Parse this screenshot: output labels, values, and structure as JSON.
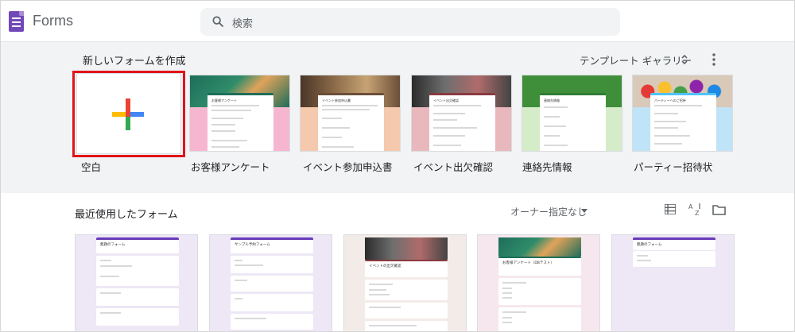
{
  "header": {
    "app_title": "Forms",
    "search_placeholder": "検索"
  },
  "templates": {
    "section_title": "新しいフォームを作成",
    "gallery_label": "テンプレート ギャラリー",
    "items": [
      {
        "label": "空白"
      },
      {
        "label": "お客様アンケート",
        "form_title": "お客様アンケート",
        "banner_color": "#1e6d5a",
        "bg_color": "#f6b6cf"
      },
      {
        "label": "イベント参加申込書",
        "form_title": "イベント参加申込書",
        "banner_color": "#5a4330",
        "bg_color": "#f5c9ad"
      },
      {
        "label": "イベント出欠確認",
        "form_title": "イベント出欠確認",
        "banner_color": "#3a3a3a",
        "bg_color": "#e9b8bd"
      },
      {
        "label": "連絡先情報",
        "form_title": "連絡先情報",
        "banner_color": "#3f8f3a",
        "bg_color": "#d4ecc8"
      },
      {
        "label": "パーティー招待状",
        "form_title": "パーティーへのご招待",
        "banner_color": "#c9d7e6",
        "bg_color": "#bfe3f7"
      }
    ]
  },
  "recent": {
    "section_title": "最近使用したフォーム",
    "owner_filter": "オーナー指定なし",
    "forms": [
      {
        "title": "無題のフォーム"
      },
      {
        "title": "サンプル予約フォーム"
      },
      {
        "title": "イベントの出欠確認"
      },
      {
        "title": "お客様アンケート（DBテスト）"
      },
      {
        "title": "無題のフォーム"
      }
    ]
  },
  "colors": {
    "accent": "#673ab7",
    "highlight": "#e0141a",
    "plus_red": "#ea4335",
    "plus_blue": "#4285f4",
    "plus_green": "#34a853",
    "plus_yellow": "#fbbc04"
  },
  "icons": [
    "forms-logo-icon",
    "search-icon",
    "unfold-icon",
    "more-vert-icon",
    "add-plus-icon",
    "list-view-icon",
    "sort-az-icon",
    "folder-icon",
    "dropdown-caret-icon"
  ]
}
